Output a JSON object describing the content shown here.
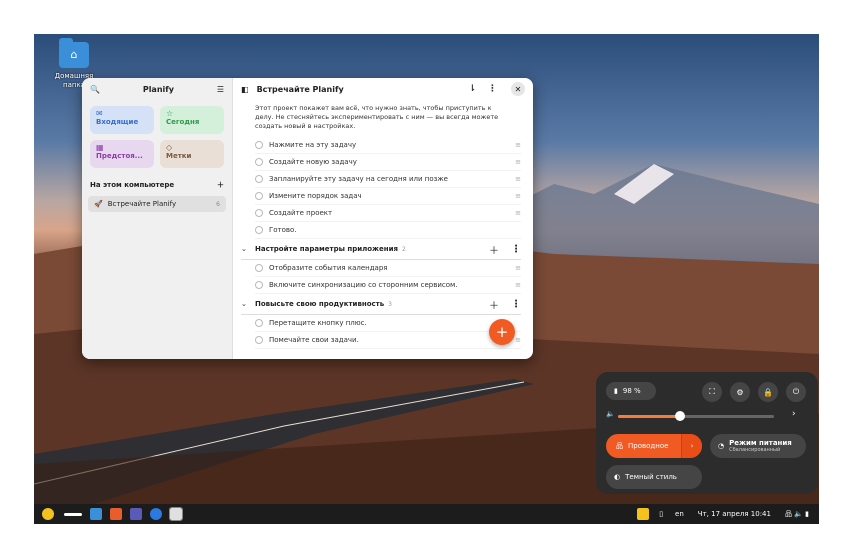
{
  "desktop": {
    "home_label": "Домашняя папка"
  },
  "sidebar": {
    "title": "Planify",
    "tiles": [
      {
        "label": "Входящие",
        "icon": "inbox-icon"
      },
      {
        "label": "Сегодня",
        "icon": "star-icon"
      },
      {
        "label": "Предстоя...",
        "icon": "calendar-icon"
      },
      {
        "label": "Метки",
        "icon": "tag-icon"
      }
    ],
    "section": "На этом компьютере",
    "project": {
      "name": "Встречайте Planify",
      "count": "6"
    }
  },
  "main": {
    "title": "Встречайте Planify",
    "description": "Этот проект покажет вам всё, что нужно знать, чтобы приступить к делу. Не стесняйтесь экспериментировать с ним — вы всегда можете создать новый в настройках.",
    "tasks": [
      "Нажмите на эту задачу",
      "Создайте новую задачу",
      "Запланируйте эту задачу на сегодня или позже",
      "Измените порядок задач",
      "Создайте проект",
      "Готово."
    ],
    "sections": [
      {
        "title": "Настройте параметры приложения",
        "count": "2",
        "tasks": [
          "Отобразите события календаря",
          "Включите синхронизацию со сторонним сервисом."
        ]
      },
      {
        "title": "Повысьте свою продуктивность",
        "count": "3",
        "tasks": [
          "Перетащите кнопку плюс.",
          "Помечайте свои задачи."
        ]
      }
    ]
  },
  "quick_settings": {
    "battery": "98 %",
    "volume_fraction": 0.4,
    "wired": "Проводное",
    "power_mode": "Режим питания",
    "power_mode_value": "Сбалансированный",
    "dark_style": "Темный стиль"
  },
  "taskbar": {
    "lang": "en",
    "datetime": "Чт, 17 апреля 10:41"
  },
  "colors": {
    "accent": "#f15a22"
  }
}
